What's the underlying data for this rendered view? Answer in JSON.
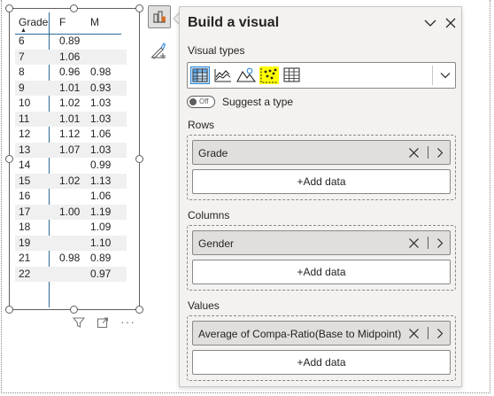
{
  "matrix": {
    "headers": {
      "grade": "Grade",
      "f": "F",
      "m": "M"
    },
    "rows": [
      {
        "grade": "6",
        "f": "0.89",
        "m": ""
      },
      {
        "grade": "7",
        "f": "1.06",
        "m": ""
      },
      {
        "grade": "8",
        "f": "0.96",
        "m": "0.98"
      },
      {
        "grade": "9",
        "f": "1.01",
        "m": "0.93"
      },
      {
        "grade": "10",
        "f": "1.02",
        "m": "1.03"
      },
      {
        "grade": "11",
        "f": "1.01",
        "m": "1.03"
      },
      {
        "grade": "12",
        "f": "1.12",
        "m": "1.06"
      },
      {
        "grade": "13",
        "f": "1.07",
        "m": "1.03"
      },
      {
        "grade": "14",
        "f": "",
        "m": "0.99"
      },
      {
        "grade": "15",
        "f": "1.02",
        "m": "1.13"
      },
      {
        "grade": "16",
        "f": "",
        "m": "1.06"
      },
      {
        "grade": "17",
        "f": "1.00",
        "m": "1.19"
      },
      {
        "grade": "18",
        "f": "",
        "m": "1.09"
      },
      {
        "grade": "19",
        "f": "",
        "m": "1.10"
      },
      {
        "grade": "21",
        "f": "0.98",
        "m": "0.89"
      },
      {
        "grade": "22",
        "f": "",
        "m": "0.97"
      }
    ],
    "icons": {
      "filter": "filter-icon",
      "focus": "focus-mode-icon",
      "more": "more-options-icon"
    },
    "more_glyph": "···"
  },
  "rail": {
    "build_icon": "build-visual-icon",
    "format_icon": "format-visual-icon"
  },
  "pane": {
    "title": "Build a visual",
    "visual_types_label": "Visual types",
    "visual_types": [
      "matrix",
      "line-chart",
      "map",
      "scatter-chart",
      "table"
    ],
    "toggle_text": "Off",
    "suggest_label": "Suggest a type",
    "rows_label": "Rows",
    "rows_field": "Grade",
    "columns_label": "Columns",
    "columns_field": "Gender",
    "values_label": "Values",
    "values_field": "Average of Compa-Ratio(Base to Midpoint)",
    "add_data": "+Add data"
  },
  "colors": {
    "accent": "#2b6a94",
    "row_alt": "#f0f0f0",
    "pane_bg": "#f3f2f1",
    "field_bg": "#e1dfdd",
    "highlight": "#ffff00"
  }
}
